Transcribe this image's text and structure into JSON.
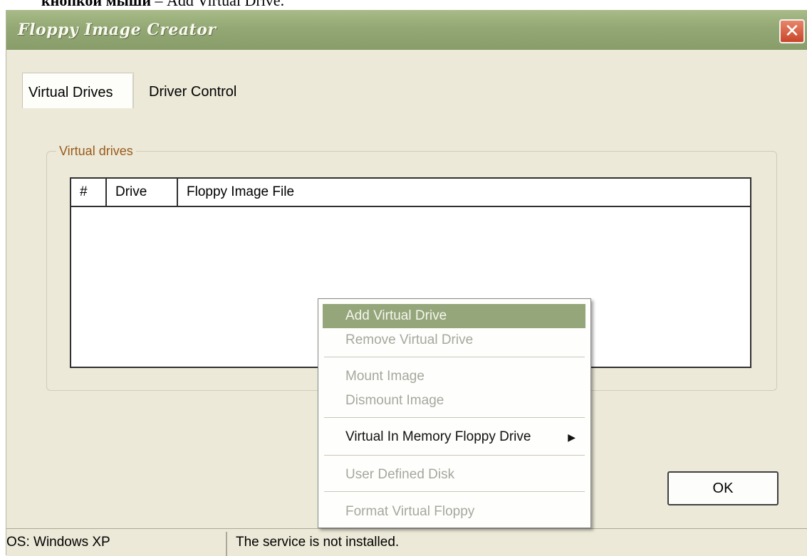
{
  "document": {
    "text_bold": "кнопкой мыши",
    "text_rest": " – Add Virtual Drive."
  },
  "window": {
    "title": "Floppy Image Creator",
    "close_symbol": "✕"
  },
  "tabs": [
    {
      "label": "Virtual Drives",
      "active": true
    },
    {
      "label": "Driver Control",
      "active": false
    }
  ],
  "group": {
    "label": "Virtual drives",
    "table": {
      "columns": [
        "#",
        "Drive",
        "Floppy Image File"
      ],
      "rows": []
    }
  },
  "buttons": {
    "ok": "OK"
  },
  "status": {
    "os": "OS: Windows XP",
    "message": "The service is not installed."
  },
  "context_menu": {
    "items": [
      {
        "label": "Add Virtual Drive",
        "state": "highlighted"
      },
      {
        "label": "Remove Virtual Drive",
        "state": "disabled"
      },
      {
        "label": "Mount Image",
        "state": "disabled"
      },
      {
        "label": "Dismount Image",
        "state": "disabled"
      },
      {
        "label": "Virtual In Memory Floppy Drive",
        "state": "enabled",
        "submenu": true,
        "arrow": "▶"
      },
      {
        "label": "User Defined Disk",
        "state": "disabled"
      },
      {
        "label": "Format Virtual Floppy",
        "state": "disabled"
      }
    ]
  },
  "colors": {
    "titlebar": "#93a874",
    "highlight": "#94a67a",
    "group_label": "#9a5a1a",
    "close": "#c8452a"
  }
}
